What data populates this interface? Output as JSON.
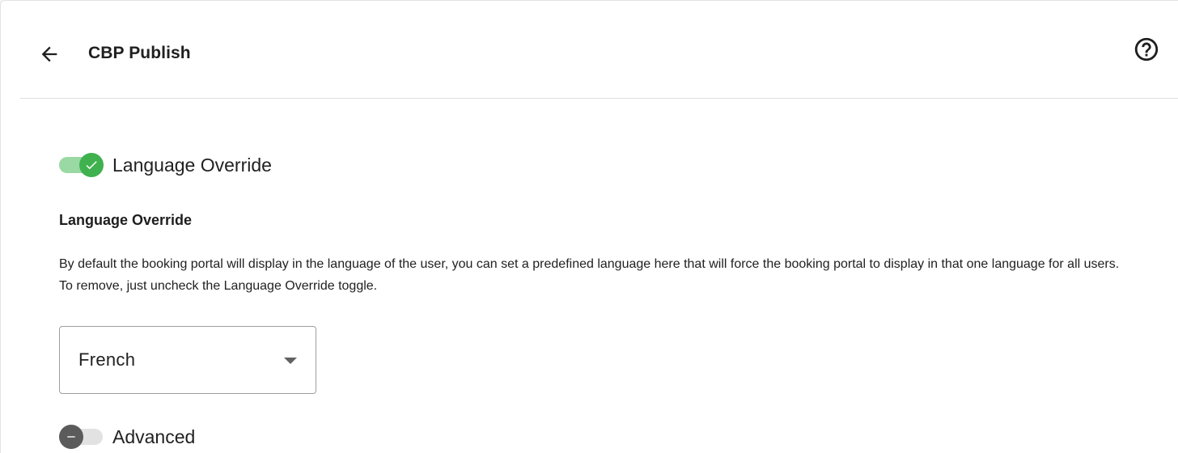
{
  "header": {
    "title": "CBP Publish",
    "back_icon": "arrow-left-icon",
    "help_icon": "help-circle-icon"
  },
  "language_override_toggle": {
    "label": "Language Override",
    "checked": true,
    "color": "#3fb14f"
  },
  "language_section": {
    "heading": "Language Override",
    "description": "By default the booking portal will display in the language of the user, you can set a predefined language here that will force the booking portal to display in that one language for all users. To remove, just uncheck the Language Override toggle."
  },
  "language_select": {
    "value": "French"
  },
  "advanced_toggle": {
    "label": "Advanced",
    "checked": false
  }
}
